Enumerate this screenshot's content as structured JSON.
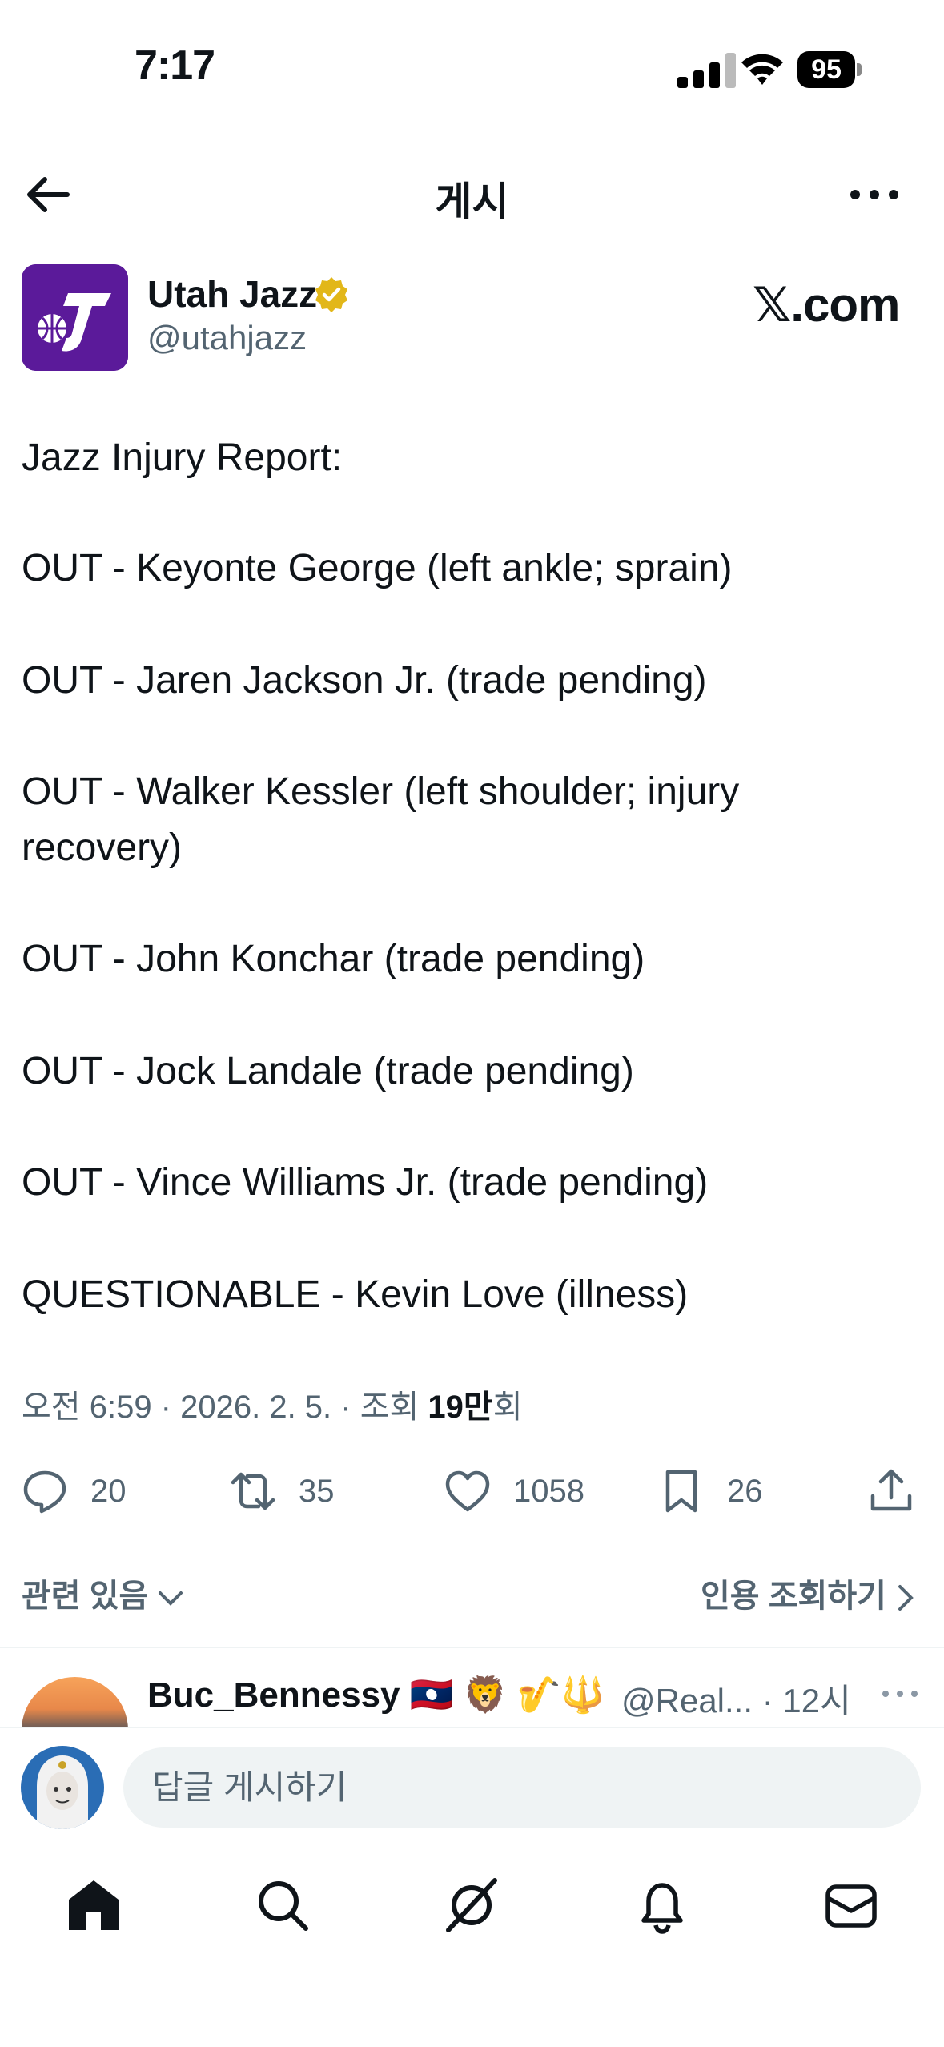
{
  "status_bar": {
    "time": "7:17",
    "battery": "95"
  },
  "header": {
    "title": "게시"
  },
  "author": {
    "name": "Utah Jazz",
    "handle": "@utahjazz",
    "watermark": "𝕏.com"
  },
  "tweet": {
    "lines": [
      "Jazz Injury Report:",
      "OUT - Keyonte George (left ankle; sprain)",
      "OUT - Jaren Jackson Jr. (trade pending)",
      "OUT - Walker Kessler (left shoulder; injury",
      "recovery)",
      "OUT - John Konchar (trade pending)",
      "OUT - Jock Landale (trade pending)",
      "OUT - Vince Williams Jr. (trade pending)",
      "QUESTIONABLE - Kevin Love (illness)"
    ]
  },
  "meta": {
    "prefix": "오전 6:59 · 2026. 2. 5. · 조회 ",
    "views": "19만",
    "suffix": "회"
  },
  "actions": {
    "replies": "20",
    "retweets": "35",
    "likes": "1058",
    "bookmarks": "26"
  },
  "links": {
    "related": "관련 있음",
    "quote": "인용 조회하기"
  },
  "reply_preview": {
    "name": "Buc_Bennessy 🇱🇦 🦁 🎷🔱",
    "handle": "@Real... · 12시"
  },
  "composer": {
    "placeholder": "답글 게시하기"
  },
  "tabbar": [
    "home-icon",
    "search-icon",
    "grok-icon",
    "notifications-icon",
    "messages-icon"
  ]
}
